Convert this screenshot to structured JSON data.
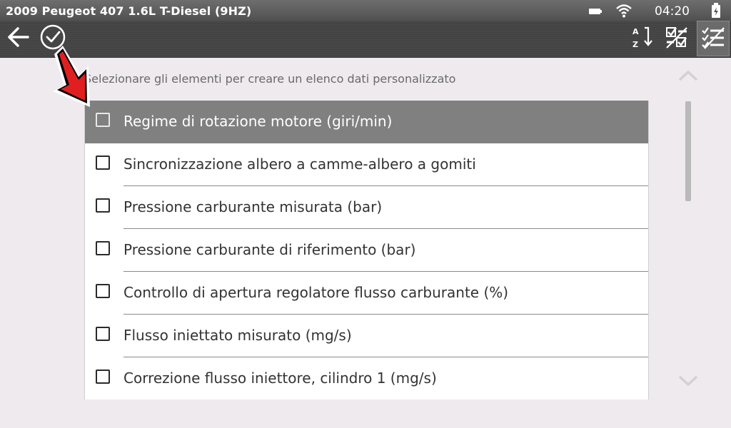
{
  "statusbar": {
    "vehicle_title": "2009 Peugeot 407 1.6L T-Diesel (9HZ)",
    "time": "04:20",
    "icons": [
      "battery-icon",
      "wifi-icon",
      "charging-icon"
    ]
  },
  "toolbar": {
    "left": [
      "back-arrow-icon",
      "check-circle-icon"
    ],
    "right": [
      "sort-az-icon",
      "select-unselect-icon",
      "custom-list-icon"
    ]
  },
  "instruction": "Selezionare gli elementi per creare un elenco dati personalizzato",
  "items": [
    {
      "label": "Regime di rotazione motore (giri/min)",
      "checked": false,
      "highlighted": true
    },
    {
      "label": "Sincronizzazione albero a camme-albero a gomiti",
      "checked": false,
      "highlighted": false
    },
    {
      "label": "Pressione carburante misurata (bar)",
      "checked": false,
      "highlighted": false
    },
    {
      "label": "Pressione carburante di riferimento (bar)",
      "checked": false,
      "highlighted": false
    },
    {
      "label": "Controllo di apertura regolatore flusso carburante (%)",
      "checked": false,
      "highlighted": false
    },
    {
      "label": "Flusso iniettato misurato (mg/s)",
      "checked": false,
      "highlighted": false
    },
    {
      "label": "Correzione flusso iniettore, cilindro 1 (mg/s)",
      "checked": false,
      "highlighted": false
    }
  ],
  "colors": {
    "annotation_arrow": "#e02020",
    "highlight_row": "#808080",
    "background": "#eeeaed"
  }
}
